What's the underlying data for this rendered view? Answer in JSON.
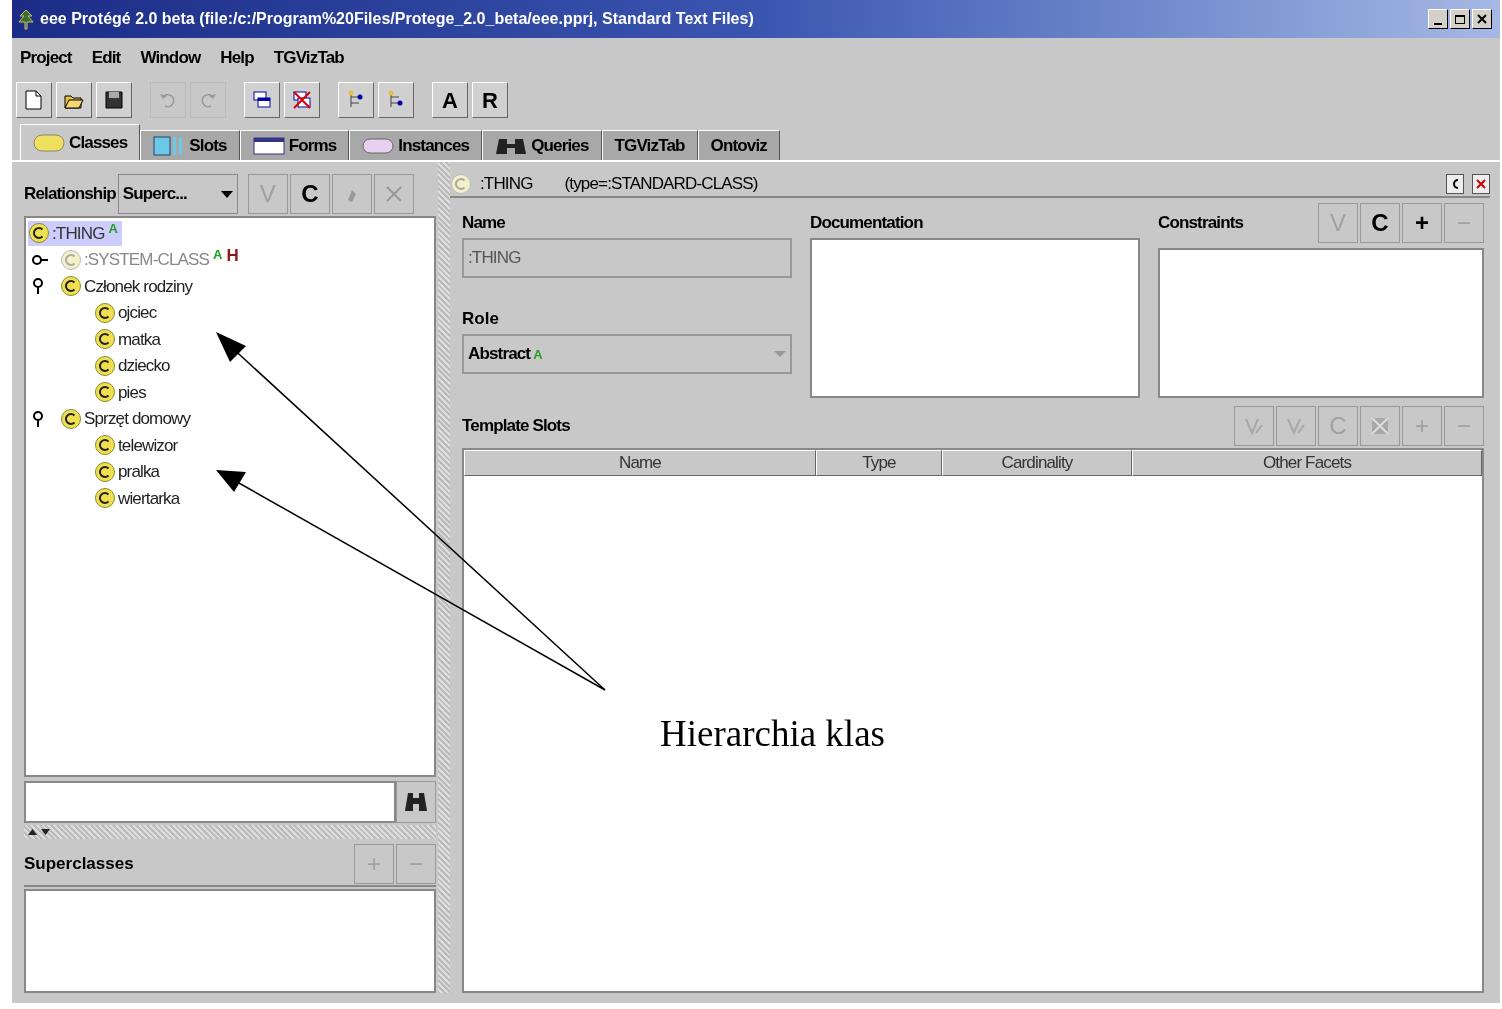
{
  "window": {
    "title": "eee  Protégé 2.0 beta   (file:/c:/Program%20Files/Protege_2.0_beta/eee.pprj, Standard Text Files)"
  },
  "menu": [
    "Project",
    "Edit",
    "Window",
    "Help",
    "TGVizTab"
  ],
  "toolbar": [
    {
      "kind": "icon",
      "disabled": false
    },
    {
      "kind": "icon",
      "disabled": false
    },
    {
      "kind": "icon",
      "disabled": false
    },
    {
      "kind": "icon",
      "disabled": true
    },
    {
      "kind": "icon",
      "disabled": true
    },
    {
      "kind": "icon",
      "disabled": false
    },
    {
      "kind": "icon",
      "disabled": false
    },
    {
      "kind": "icon",
      "disabled": false
    },
    {
      "kind": "icon",
      "disabled": false
    },
    {
      "kind": "text",
      "label": "A",
      "disabled": false
    },
    {
      "kind": "text",
      "label": "R",
      "disabled": false
    }
  ],
  "tabs": [
    {
      "label": "Classes",
      "selected": true
    },
    {
      "label": "Slots",
      "selected": false
    },
    {
      "label": "Forms",
      "selected": false
    },
    {
      "label": "Instances",
      "selected": false
    },
    {
      "label": "Queries",
      "selected": false
    },
    {
      "label": "TGVizTab",
      "selected": false
    },
    {
      "label": "Ontoviz",
      "selected": false
    }
  ],
  "class_panel": {
    "relationship_label": "Relationship",
    "relationship_value": "Superc...",
    "buttons": [
      {
        "kind": "text",
        "label": "V",
        "disabled": true
      },
      {
        "kind": "text",
        "label": "C",
        "disabled": false
      },
      {
        "kind": "icon",
        "disabled": true
      },
      {
        "kind": "icon",
        "disabled": true
      }
    ],
    "tree": [
      {
        "label": ":THING",
        "selected": true,
        "hidden": false,
        "badges": [
          {
            "text": "A",
            "color": "#22a022"
          }
        ],
        "children": [
          {
            "label": ":SYSTEM-CLASS",
            "selected": false,
            "hidden": true,
            "expanded": false,
            "badges": [
              {
                "text": "A",
                "color": "#22a022"
              },
              {
                "text": "H",
                "color": "#8b1a1a"
              }
            ]
          },
          {
            "label": "Członek rodziny",
            "selected": false,
            "hidden": false,
            "expanded": true,
            "children": [
              {
                "label": "ojciec",
                "selected": false,
                "hidden": false
              },
              {
                "label": "matka",
                "selected": false,
                "hidden": false
              },
              {
                "label": "dziecko",
                "selected": false,
                "hidden": false
              },
              {
                "label": "pies",
                "selected": false,
                "hidden": false
              }
            ]
          },
          {
            "label": "Sprzęt domowy",
            "selected": false,
            "hidden": false,
            "expanded": true,
            "children": [
              {
                "label": "telewizor",
                "selected": false,
                "hidden": false
              },
              {
                "label": "pralka",
                "selected": false,
                "hidden": false
              },
              {
                "label": "wiertarka",
                "selected": false,
                "hidden": false
              }
            ]
          }
        ]
      }
    ],
    "superclasses": {
      "title": "Superclasses",
      "buttons": [
        {
          "label": "+",
          "disabled": true
        },
        {
          "label": "−",
          "disabled": true
        }
      ]
    }
  },
  "class_form": {
    "name": ":THING",
    "type": "(type=:STANDARD-CLASS)",
    "name_label": "Name",
    "name_value": ":THING",
    "role_label": "Role",
    "role_value": "Abstract",
    "role_badge": "A",
    "documentation_label": "Documentation",
    "constraints_label": "Constraints",
    "constraint_buttons": [
      {
        "label": "V",
        "disabled": true
      },
      {
        "label": "C",
        "disabled": false
      },
      {
        "label": "+",
        "disabled": false
      },
      {
        "label": "−",
        "disabled": true
      }
    ],
    "template_slots_label": "Template Slots",
    "slot_buttons": [
      {
        "kind": "icon",
        "disabled": true
      },
      {
        "kind": "icon",
        "disabled": true
      },
      {
        "kind": "text",
        "label": "C",
        "disabled": true
      },
      {
        "kind": "icon",
        "disabled": true
      },
      {
        "kind": "text",
        "label": "+",
        "disabled": true
      },
      {
        "kind": "text",
        "label": "−",
        "disabled": true
      }
    ],
    "columns": [
      "Name",
      "Type",
      "Cardinality",
      "Other Facets"
    ]
  },
  "annotation": {
    "text": "Hierarchia klas"
  }
}
